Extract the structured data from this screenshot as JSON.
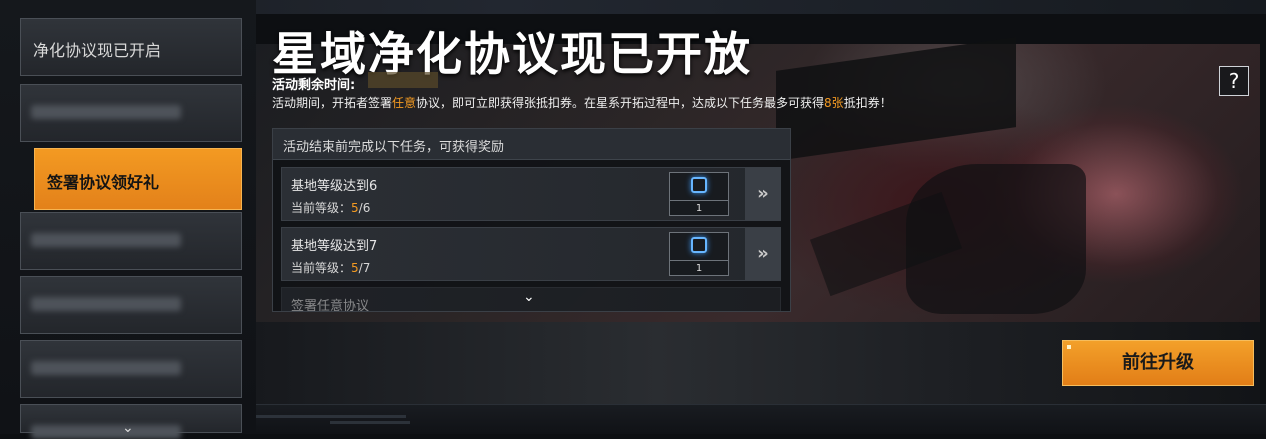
{
  "sidebar": {
    "items": [
      {
        "label": "净化协议现已开启",
        "state": "normal"
      },
      {
        "label": "",
        "state": "blurred"
      },
      {
        "label": "签署协议领好礼",
        "state": "active"
      },
      {
        "label": "",
        "state": "blurred"
      },
      {
        "label": "",
        "state": "blurred"
      },
      {
        "label": "",
        "state": "blurred"
      },
      {
        "label": "",
        "state": "blurred"
      }
    ],
    "more_icon": "chevron-down-icon"
  },
  "header": {
    "title": "星域净化协议现已开放",
    "remaining_time_label": "活动剩余时间:",
    "description_parts": [
      "活动期间，开拓者签署",
      "任意",
      "协议，即可立即获得张抵扣券。在星系开拓过程中，达成以下任务最多可获得",
      "8张",
      "抵扣券！"
    ]
  },
  "help_button": {
    "label": "?"
  },
  "task_panel": {
    "heading": "活动结束前完成以下任务，可获得奖励",
    "tasks": [
      {
        "name": "基地等级达到6",
        "progress_label": "当前等级：",
        "current": "5",
        "target": "/6",
        "reward_count": "1"
      },
      {
        "name": "基地等级达到7",
        "progress_label": "当前等级：",
        "current": "5",
        "target": "/7",
        "reward_count": "1"
      },
      {
        "name": "签署任意协议"
      }
    ],
    "go_icon": "double-chevron-right-icon",
    "more_icon": "chevron-down-icon"
  },
  "upgrade_button": {
    "label": "前往升级"
  },
  "colors": {
    "accent": "#f39a22",
    "reward_icon": "#67b6ff"
  }
}
